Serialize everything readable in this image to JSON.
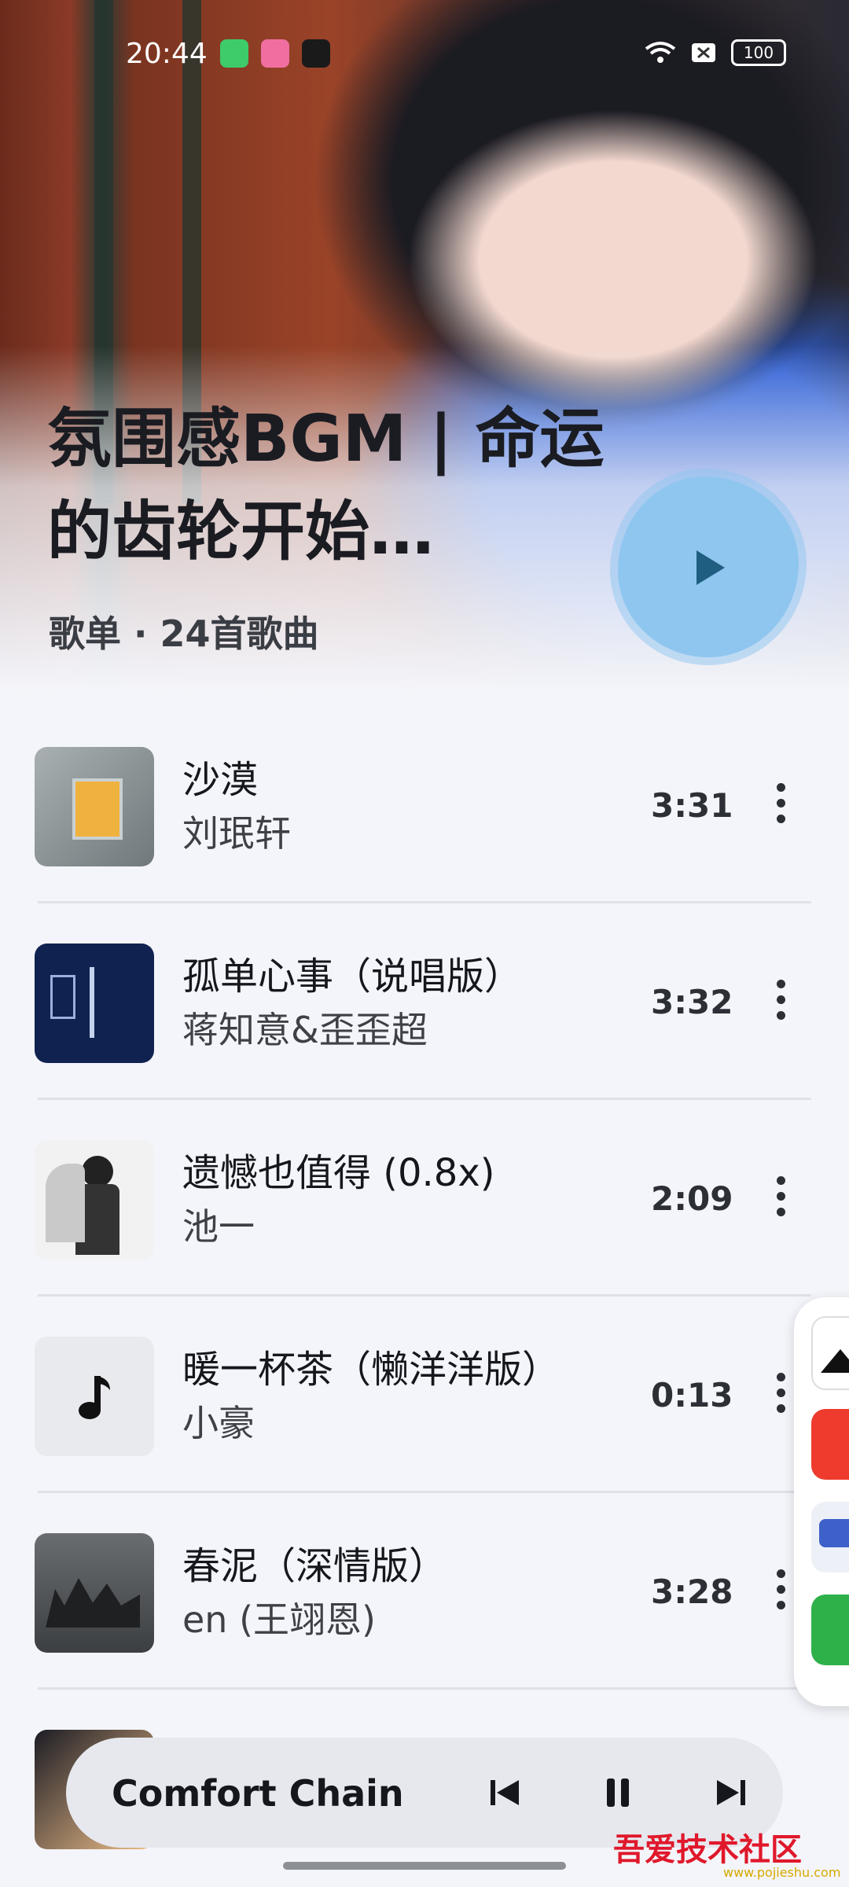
{
  "status": {
    "time": "20:44",
    "battery": "100"
  },
  "header": {
    "title": "氛围感BGM | 命运的齿轮开始…",
    "subtitle": "歌单 · 24首歌曲"
  },
  "songs": [
    {
      "title": "沙漠",
      "artist": "刘珉轩",
      "duration": "3:31",
      "cover_color": "#8e9698"
    },
    {
      "title": "孤单心事（说唱版）",
      "artist": "蒋知意&歪歪超",
      "duration": "3:32",
      "cover_color": "#0f2250"
    },
    {
      "title": "遗憾也值得 (0.8x)",
      "artist": "池一",
      "duration": "2:09",
      "cover_color": "#e8e8e8"
    },
    {
      "title": "暖一杯茶（懒洋洋版）",
      "artist": "小豪",
      "duration": "0:13",
      "cover_color": "#e9eaee"
    },
    {
      "title": "春泥（深情版）",
      "artist": "en (王翊恩)",
      "duration": "3:28",
      "cover_color": "#4a4d50"
    }
  ],
  "player": {
    "now_playing": "Comfort Chain"
  },
  "watermark": {
    "text": "吾爱技术社区",
    "url": "www.pojieshu.com"
  },
  "colors": {
    "accent": "#8fc6ef",
    "play_icon": "#1f5e80"
  }
}
